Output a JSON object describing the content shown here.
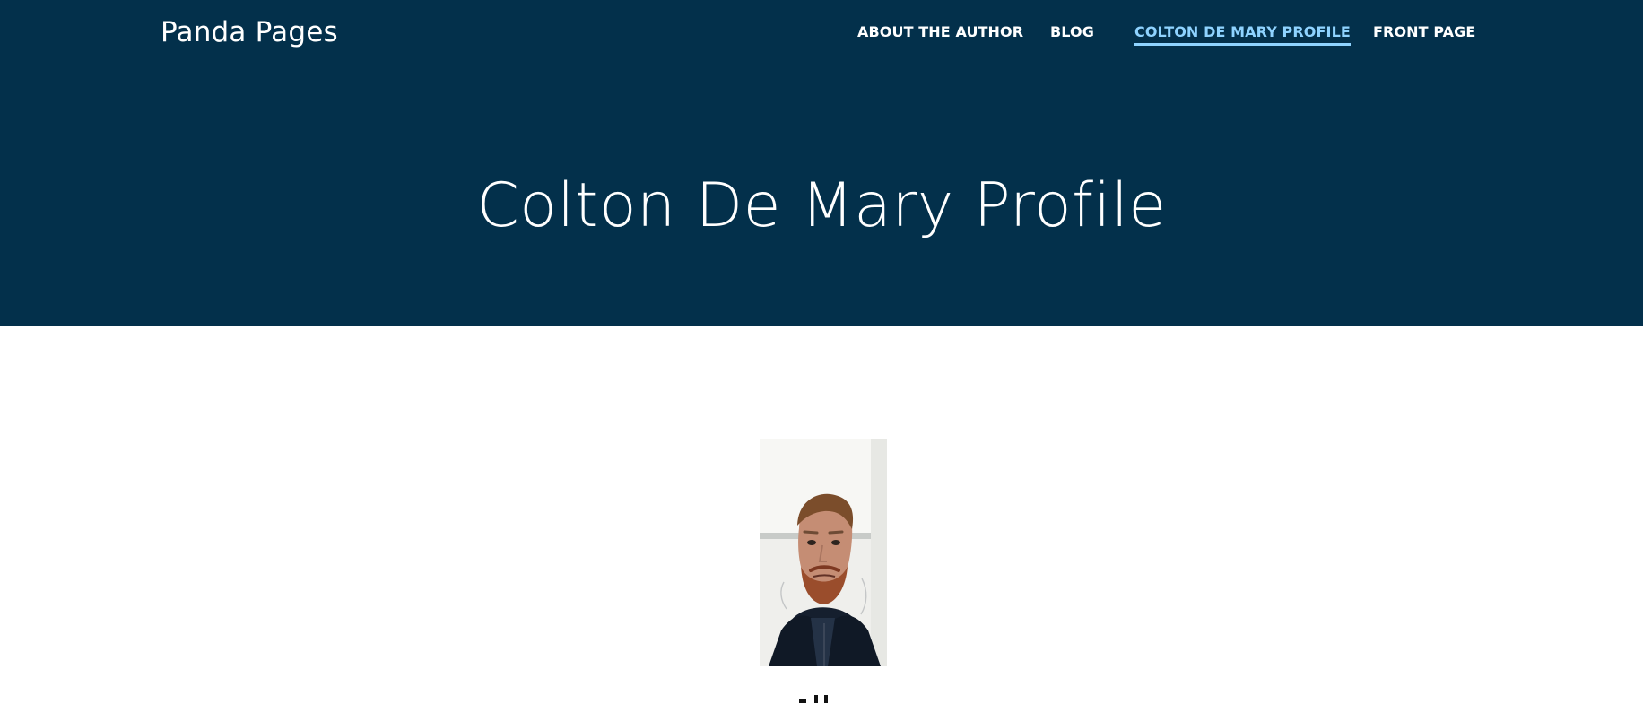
{
  "site": {
    "title": "Panda Pages"
  },
  "nav": {
    "items": [
      {
        "label": "ABOUT THE AUTHOR"
      },
      {
        "label": "BLOG"
      },
      {
        "label": "COLTON DE MARY PROFILE",
        "active": true
      },
      {
        "label": "FRONT PAGE"
      }
    ]
  },
  "page": {
    "title": "Colton De Mary Profile"
  },
  "colors": {
    "header_bg": "#03304b",
    "active_nav": "#8fd3ff",
    "text_white": "#ffffff"
  }
}
